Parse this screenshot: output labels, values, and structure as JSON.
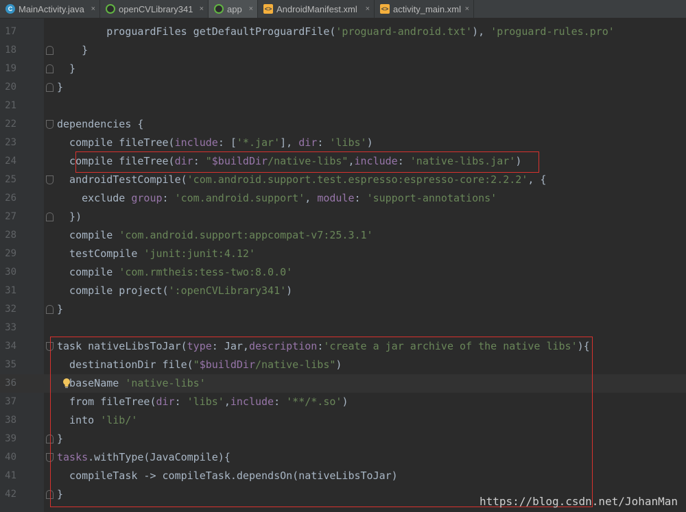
{
  "tabs": [
    {
      "label": "MainActivity.java",
      "icon": "class-icon",
      "active": false
    },
    {
      "label": "openCVLibrary341",
      "icon": "gradle-icon",
      "active": false
    },
    {
      "label": "app",
      "icon": "gradle-icon",
      "active": true
    },
    {
      "label": "AndroidManifest.xml",
      "icon": "xml-icon",
      "active": false
    },
    {
      "label": "activity_main.xml",
      "icon": "xml-icon",
      "active": false
    }
  ],
  "close_glyph": "×",
  "colors": {
    "background": "#2b2b2b",
    "plain": "#a9b7c6",
    "string": "#6a8759",
    "param": "#9876aa",
    "line_number": "#606366",
    "highlight_box": "#d9322e"
  },
  "lines": [
    {
      "number": "17",
      "fold": "",
      "segments": [
        {
          "t": "        proguardFiles getDefaultProguardFile(",
          "c": "plain"
        },
        {
          "t": "'proguard-android.txt'",
          "c": "string"
        },
        {
          "t": "), ",
          "c": "plain"
        },
        {
          "t": "'proguard-rules.pro'",
          "c": "string"
        }
      ]
    },
    {
      "number": "18",
      "fold": "end",
      "segments": [
        {
          "t": "    }",
          "c": "plain"
        }
      ]
    },
    {
      "number": "19",
      "fold": "end",
      "segments": [
        {
          "t": "  }",
          "c": "plain"
        }
      ]
    },
    {
      "number": "20",
      "fold": "end",
      "segments": [
        {
          "t": "}",
          "c": "plain"
        }
      ]
    },
    {
      "number": "21",
      "fold": "",
      "segments": []
    },
    {
      "number": "22",
      "fold": "start",
      "segments": [
        {
          "t": "dependencies {",
          "c": "plain"
        }
      ]
    },
    {
      "number": "23",
      "fold": "",
      "segments": [
        {
          "t": "  compile fileTree(",
          "c": "plain"
        },
        {
          "t": "include",
          "c": "param"
        },
        {
          "t": ": [",
          "c": "plain"
        },
        {
          "t": "'*.jar'",
          "c": "string"
        },
        {
          "t": "], ",
          "c": "plain"
        },
        {
          "t": "dir",
          "c": "param"
        },
        {
          "t": ": ",
          "c": "plain"
        },
        {
          "t": "'libs'",
          "c": "string"
        },
        {
          "t": ")",
          "c": "plain"
        }
      ]
    },
    {
      "number": "24",
      "fold": "",
      "segments": [
        {
          "t": "  compile fileTree(",
          "c": "plain"
        },
        {
          "t": "dir",
          "c": "param"
        },
        {
          "t": ": ",
          "c": "plain"
        },
        {
          "t": "\"",
          "c": "string"
        },
        {
          "t": "$buildDir",
          "c": "param"
        },
        {
          "t": "/native-libs\"",
          "c": "string"
        },
        {
          "t": ",",
          "c": "plain"
        },
        {
          "t": "include",
          "c": "param"
        },
        {
          "t": ": ",
          "c": "plain"
        },
        {
          "t": "'native-libs.jar'",
          "c": "string"
        },
        {
          "t": ")",
          "c": "plain"
        }
      ]
    },
    {
      "number": "25",
      "fold": "start",
      "segments": [
        {
          "t": "  androidTestCompile(",
          "c": "plain"
        },
        {
          "t": "'com.android.support.test.espresso:espresso-core:2.2.2'",
          "c": "string"
        },
        {
          "t": ", {",
          "c": "plain"
        }
      ]
    },
    {
      "number": "26",
      "fold": "",
      "segments": [
        {
          "t": "    exclude ",
          "c": "plain"
        },
        {
          "t": "group",
          "c": "param"
        },
        {
          "t": ": ",
          "c": "plain"
        },
        {
          "t": "'com.android.support'",
          "c": "string"
        },
        {
          "t": ", ",
          "c": "plain"
        },
        {
          "t": "module",
          "c": "param"
        },
        {
          "t": ": ",
          "c": "plain"
        },
        {
          "t": "'support-annotations'",
          "c": "string"
        }
      ]
    },
    {
      "number": "27",
      "fold": "end",
      "segments": [
        {
          "t": "  })",
          "c": "plain"
        }
      ]
    },
    {
      "number": "28",
      "fold": "",
      "segments": [
        {
          "t": "  compile ",
          "c": "plain"
        },
        {
          "t": "'com.android.support:appcompat-v7:25.3.1'",
          "c": "string"
        }
      ]
    },
    {
      "number": "29",
      "fold": "",
      "segments": [
        {
          "t": "  testCompile ",
          "c": "plain"
        },
        {
          "t": "'junit:junit:4.12'",
          "c": "string"
        }
      ]
    },
    {
      "number": "30",
      "fold": "",
      "segments": [
        {
          "t": "  compile ",
          "c": "plain"
        },
        {
          "t": "'com.rmtheis:tess-two:8.0.0'",
          "c": "string"
        }
      ]
    },
    {
      "number": "31",
      "fold": "",
      "segments": [
        {
          "t": "  compile project(",
          "c": "plain"
        },
        {
          "t": "':openCVLibrary341'",
          "c": "string"
        },
        {
          "t": ")",
          "c": "plain"
        }
      ]
    },
    {
      "number": "32",
      "fold": "end",
      "segments": [
        {
          "t": "}",
          "c": "plain"
        }
      ]
    },
    {
      "number": "33",
      "fold": "",
      "segments": []
    },
    {
      "number": "34",
      "fold": "start",
      "segments": [
        {
          "t": "task nativeLibsToJar(",
          "c": "plain"
        },
        {
          "t": "type",
          "c": "param"
        },
        {
          "t": ": Jar,",
          "c": "plain"
        },
        {
          "t": "description",
          "c": "param"
        },
        {
          "t": ":",
          "c": "plain"
        },
        {
          "t": "'create a jar archive of the native libs'",
          "c": "string"
        },
        {
          "t": "){",
          "c": "plain"
        }
      ]
    },
    {
      "number": "35",
      "fold": "",
      "segments": [
        {
          "t": "  destinationDir file(",
          "c": "plain"
        },
        {
          "t": "\"",
          "c": "string"
        },
        {
          "t": "$buildDir",
          "c": "param"
        },
        {
          "t": "/native-libs\"",
          "c": "string"
        },
        {
          "t": ")",
          "c": "plain"
        }
      ]
    },
    {
      "number": "36",
      "fold": "",
      "bulb": true,
      "segments": [
        {
          "t": "  baseName ",
          "c": "plain"
        },
        {
          "t": "'native-libs'",
          "c": "string"
        }
      ]
    },
    {
      "number": "37",
      "fold": "",
      "segments": [
        {
          "t": "  from fileTree(",
          "c": "plain"
        },
        {
          "t": "dir",
          "c": "param"
        },
        {
          "t": ": ",
          "c": "plain"
        },
        {
          "t": "'libs'",
          "c": "string"
        },
        {
          "t": ",",
          "c": "plain"
        },
        {
          "t": "include",
          "c": "param"
        },
        {
          "t": ": ",
          "c": "plain"
        },
        {
          "t": "'**/*.so'",
          "c": "string"
        },
        {
          "t": ")",
          "c": "plain"
        }
      ]
    },
    {
      "number": "38",
      "fold": "",
      "segments": [
        {
          "t": "  into ",
          "c": "plain"
        },
        {
          "t": "'lib/'",
          "c": "string"
        }
      ]
    },
    {
      "number": "39",
      "fold": "end",
      "segments": [
        {
          "t": "}",
          "c": "plain"
        }
      ]
    },
    {
      "number": "40",
      "fold": "start",
      "segments": [
        {
          "t": "tasks",
          "c": "param"
        },
        {
          "t": ".withType(JavaCompile){",
          "c": "plain"
        }
      ]
    },
    {
      "number": "41",
      "fold": "",
      "segments": [
        {
          "t": "  compileTask -> compileTask.dependsOn(nativeLibsToJar)",
          "c": "plain"
        }
      ]
    },
    {
      "number": "42",
      "fold": "end",
      "segments": [
        {
          "t": "}",
          "c": "plain"
        }
      ]
    }
  ],
  "watermark": "https://blog.csdn.net/JohanMan"
}
